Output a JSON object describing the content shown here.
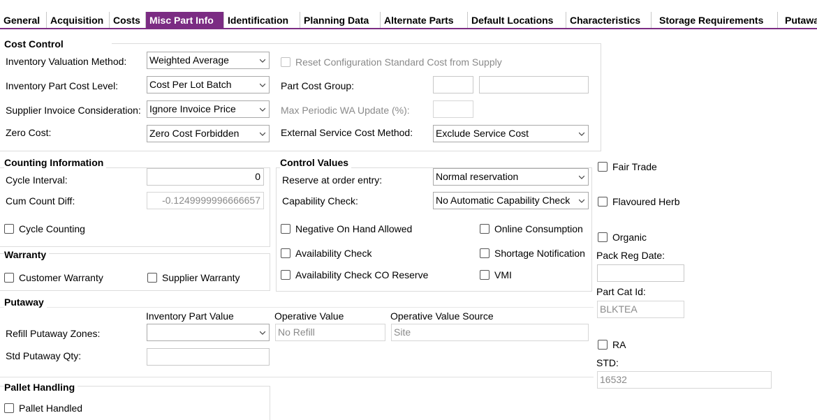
{
  "tabs": [
    {
      "label": "General"
    },
    {
      "label": "Acquisition"
    },
    {
      "label": "Costs"
    },
    {
      "label": "Misc Part Info"
    },
    {
      "label": "Identification"
    },
    {
      "label": "Planning Data"
    },
    {
      "label": "Alternate Parts"
    },
    {
      "label": "Default Locations"
    },
    {
      "label": "Characteristics"
    },
    {
      "label": "Storage Requirements"
    },
    {
      "label": "Putawa"
    }
  ],
  "active_tab": "Misc Part Info",
  "accent_color": "#7b2c83",
  "cost_control": {
    "title": "Cost Control",
    "inv_valuation_label": "Inventory Valuation Method:",
    "inv_valuation_value": "Weighted Average",
    "part_cost_level_label": "Inventory Part Cost Level:",
    "part_cost_level_value": "Cost Per Lot Batch",
    "supplier_invoice_label": "Supplier Invoice Consideration:",
    "supplier_invoice_value": "Ignore Invoice Price",
    "zero_cost_label": "Zero Cost:",
    "zero_cost_value": "Zero Cost Forbidden",
    "reset_config_label": "Reset Configuration Standard Cost from Supply",
    "part_cost_group_label": "Part Cost Group:",
    "max_periodic_label": "Max Periodic WA Update (%):",
    "ext_service_label": "External Service Cost Method:",
    "ext_service_value": "Exclude Service Cost"
  },
  "counting": {
    "title": "Counting Information",
    "cycle_interval_label": "Cycle Interval:",
    "cycle_interval_value": "0",
    "cum_count_label": "Cum Count Diff:",
    "cum_count_value": "-0.1249999996666657",
    "cycle_counting_label": "Cycle Counting"
  },
  "control_values": {
    "title": "Control Values",
    "reserve_label": "Reserve at order entry:",
    "reserve_value": "Normal reservation",
    "capability_label": "Capability Check:",
    "capability_value": "No Automatic Capability Check",
    "negative_onhand_label": "Negative On Hand Allowed",
    "online_consumption_label": "Online Consumption",
    "availability_check_label": "Availability Check",
    "shortage_notification_label": "Shortage Notification",
    "availability_co_label": "Availability Check CO Reserve",
    "vmi_label": "VMI"
  },
  "warranty": {
    "title": "Warranty",
    "customer_label": "Customer Warranty",
    "supplier_label": "Supplier Warranty"
  },
  "putaway": {
    "title": "Putaway",
    "inv_part_value_header": "Inventory Part Value",
    "operative_value_header": "Operative Value",
    "operative_source_header": "Operative Value Source",
    "refill_label": "Refill Putaway Zones:",
    "refill_operative": "No Refill",
    "refill_source": "Site",
    "std_qty_label": "Std Putaway Qty:"
  },
  "pallet": {
    "title": "Pallet Handling",
    "pallet_handled_label": "Pallet Handled"
  },
  "right_panel": {
    "fair_trade_label": "Fair Trade",
    "flavoured_herb_label": "Flavoured Herb",
    "organic_label": "Organic",
    "pack_reg_label": "Pack Reg Date:",
    "part_cat_label": "Part Cat Id:",
    "part_cat_value": "BLKTEA",
    "ra_label": "RA",
    "std_label": "STD:",
    "std_value": "16532"
  }
}
